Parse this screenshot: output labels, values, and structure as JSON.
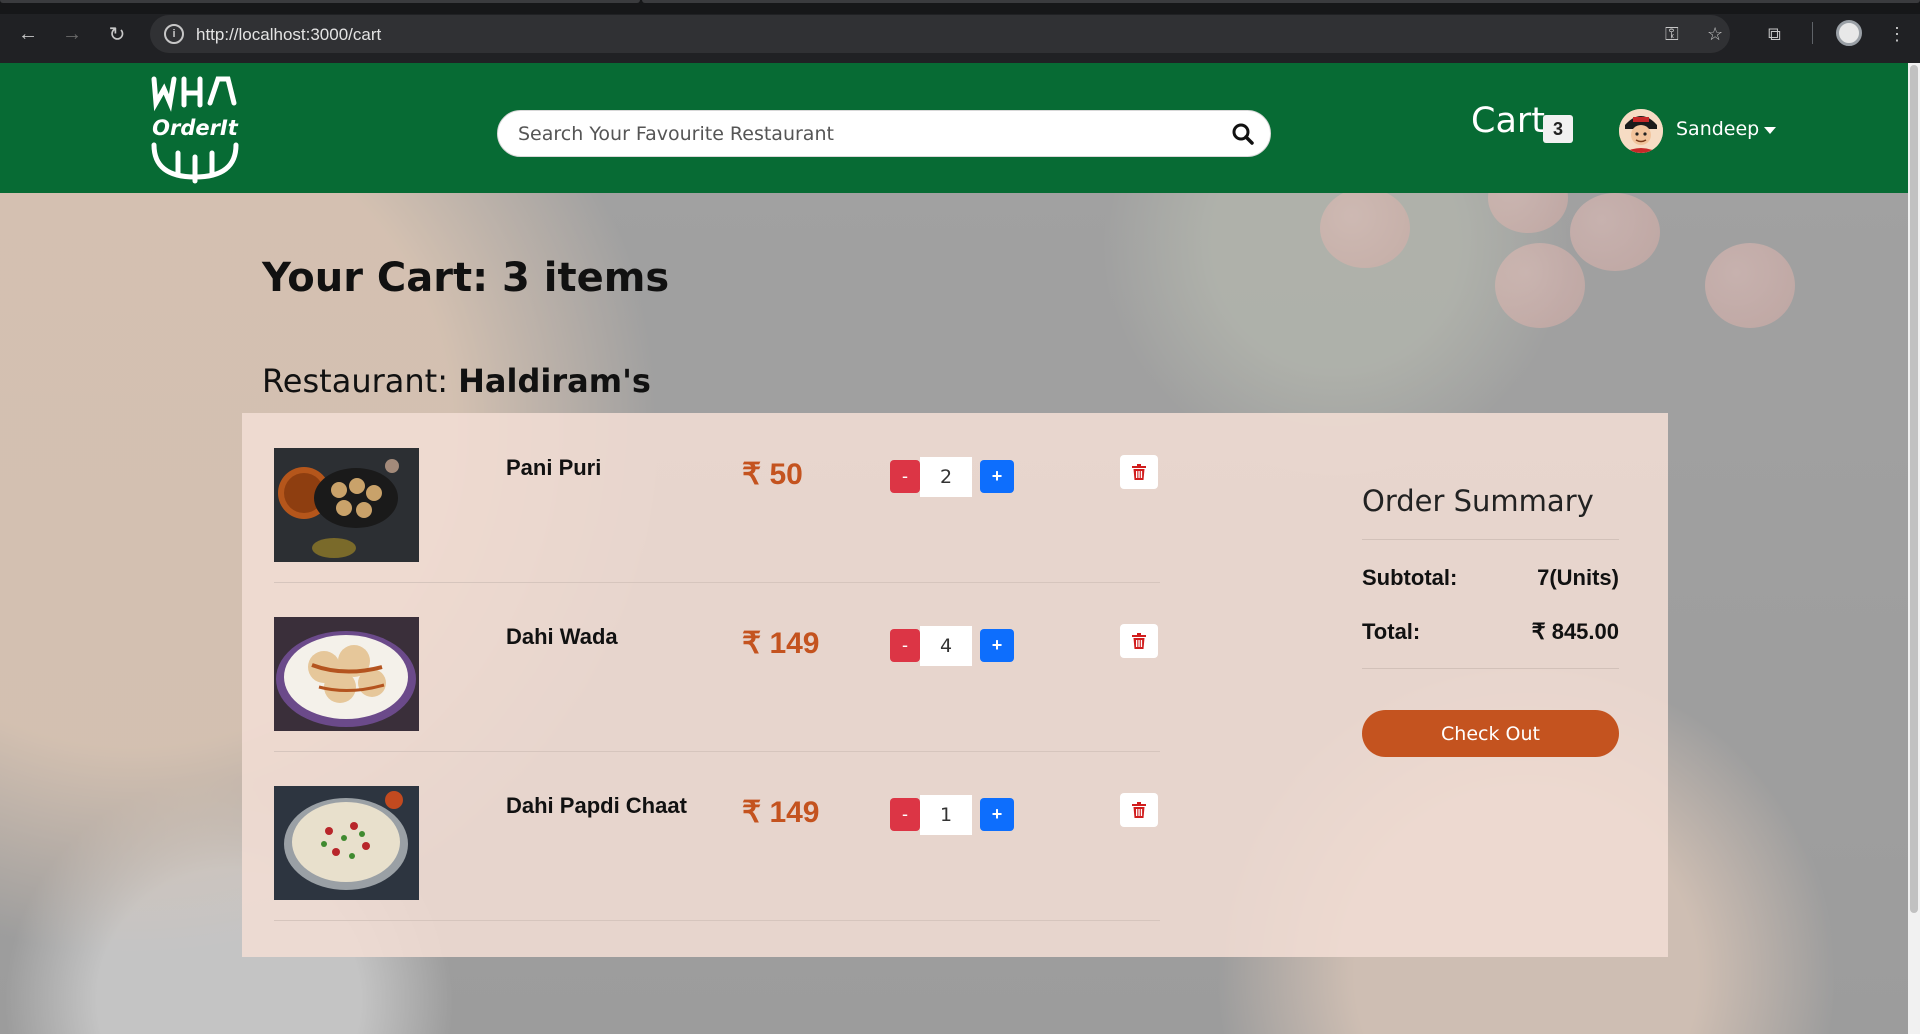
{
  "browser": {
    "url": "http://localhost:3000/cart",
    "icons": [
      "back-icon",
      "forward-icon",
      "reload-icon",
      "site-info-icon",
      "key-icon",
      "star-icon",
      "extensions-icon",
      "profile-icon",
      "menu-icon"
    ]
  },
  "header": {
    "logo_text": "OrderIt",
    "search_placeholder": "Search Your Favourite Restaurant",
    "cart_label": "Cart",
    "cart_count": "3",
    "username": "Sandeep",
    "accent_color": "#076b34"
  },
  "cart": {
    "title": "Your Cart: 3 items",
    "restaurant_label": "Restaurant:",
    "restaurant_name": "Haldiram's",
    "items": [
      {
        "name": "Pani Puri",
        "currency": "₹",
        "price": "50",
        "quantity": "2",
        "minus": "-",
        "plus": "+"
      },
      {
        "name": "Dahi Wada",
        "currency": "₹",
        "price": "149",
        "quantity": "4",
        "minus": "-",
        "plus": "+"
      },
      {
        "name": "Dahi Papdi Chaat",
        "currency": "₹",
        "price": "149",
        "quantity": "1",
        "minus": "-",
        "plus": "+"
      }
    ]
  },
  "summary": {
    "title": "Order Summary",
    "subtotal_label": "Subtotal:",
    "subtotal_value": "7(Units)",
    "total_label": "Total:",
    "total_value": "₹ 845.00",
    "checkout_label": "Check Out",
    "button_color": "#c4531f"
  }
}
